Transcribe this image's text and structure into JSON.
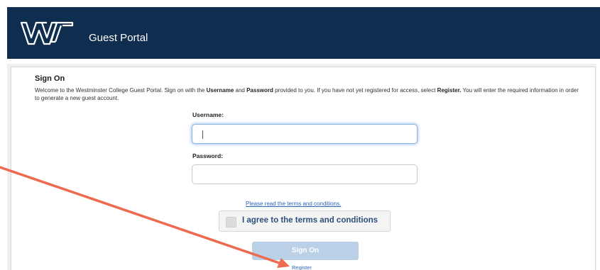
{
  "header": {
    "title": "Guest Portal",
    "background_color": "#0f2d4f"
  },
  "signon": {
    "heading": "Sign On",
    "welcome": {
      "part1": "Welcome to the Westminster College Guest Portal. Sign on with the ",
      "username_word": "Username",
      "part2": " and ",
      "password_word": "Password",
      "part3": " provided to you. If you have not yet registered for access, select ",
      "register_word": "Register.",
      "part4": " You will enter the required information in order to generate a new guest account."
    },
    "username_label": "Username:",
    "username_value": "",
    "password_label": "Password:",
    "password_value": "",
    "terms_link": "Please read the terms and conditions.",
    "agree_label": "I agree to the terms and conditions",
    "agree_checked": false,
    "signon_button": "Sign On",
    "register_link": "Register"
  },
  "icons": {
    "logo": "westminster-w-logo",
    "annotation": "red-arrow-annotation"
  },
  "colors": {
    "link": "#2b64b8",
    "button_disabled": "#b9d0e6",
    "arrow": "#ee6a4f"
  }
}
